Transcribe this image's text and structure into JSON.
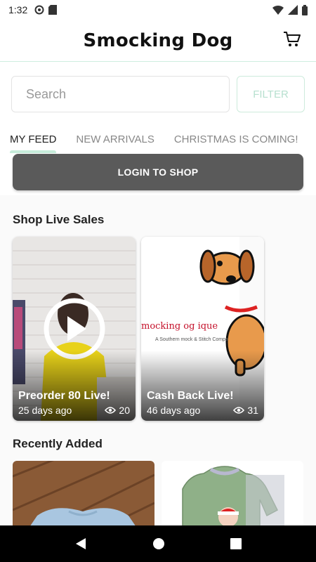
{
  "status_bar": {
    "time": "1:32"
  },
  "header": {
    "title": "Smocking Dog"
  },
  "search": {
    "placeholder": "Search",
    "filter_label": "FILTER"
  },
  "tabs": [
    {
      "label": "MY FEED",
      "active": true
    },
    {
      "label": "NEW ARRIVALS",
      "active": false
    },
    {
      "label": "CHRISTMAS IS COMING!",
      "active": false
    }
  ],
  "login_button": "LOGIN TO SHOP",
  "sections": {
    "live": {
      "title": "Shop Live Sales",
      "cards": [
        {
          "title": "Preorder 80 Live!",
          "age": "25 days ago",
          "views": "20"
        },
        {
          "title": "Cash Back Live!",
          "age": "46 days ago",
          "views": "31",
          "brand_text": "mocking  og    ique",
          "brand_sub": "A Southern   mock & Stitch Compa"
        }
      ]
    },
    "recent": {
      "title": "Recently Added"
    }
  },
  "colors": {
    "accent": "#c6ecda",
    "login_bg": "#5a5a5a"
  }
}
